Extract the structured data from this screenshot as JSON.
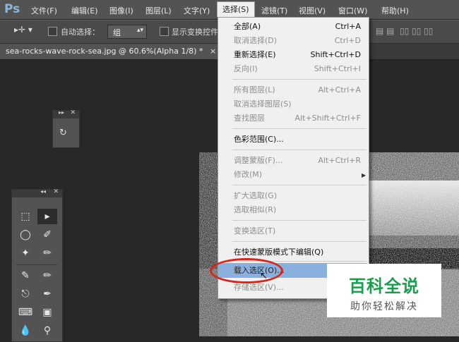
{
  "app": {
    "logo": "Ps"
  },
  "menubar": [
    {
      "label": "文件(F)"
    },
    {
      "label": "编辑(E)"
    },
    {
      "label": "图像(I)"
    },
    {
      "label": "图层(L)"
    },
    {
      "label": "文字(Y)"
    },
    {
      "label": "选择(S)"
    },
    {
      "label": "滤镜(T)"
    },
    {
      "label": "视图(V)"
    },
    {
      "label": "窗口(W)"
    },
    {
      "label": "帮助(H)"
    }
  ],
  "options": {
    "auto_select_label": "自动选择：",
    "auto_select_value": "组",
    "show_transform_label": "显示变换控件"
  },
  "document_tab": {
    "title": "sea-rocks-wave-rock-sea.jpg @ 60.6%(Alpha 1/8) *",
    "close": "×"
  },
  "select_menu": {
    "items": [
      {
        "label": "全部(A)",
        "shortcut": "Ctrl+A",
        "enabled": true
      },
      {
        "label": "取消选择(D)",
        "shortcut": "Ctrl+D",
        "enabled": false
      },
      {
        "label": "重新选择(E)",
        "shortcut": "Shift+Ctrl+D",
        "enabled": true
      },
      {
        "label": "反向(I)",
        "shortcut": "Shift+Ctrl+I",
        "enabled": false
      },
      {
        "label": "所有图层(L)",
        "shortcut": "Alt+Ctrl+A",
        "enabled": false
      },
      {
        "label": "取消选择图层(S)",
        "shortcut": "",
        "enabled": false
      },
      {
        "label": "查找图层",
        "shortcut": "Alt+Shift+Ctrl+F",
        "enabled": false
      },
      {
        "label": "色彩范围(C)...",
        "shortcut": "",
        "enabled": true
      },
      {
        "label": "调整蒙版(F)...",
        "shortcut": "Alt+Ctrl+R",
        "enabled": false
      },
      {
        "label": "修改(M)",
        "shortcut": "",
        "enabled": false,
        "submenu": true
      },
      {
        "label": "扩大选取(G)",
        "shortcut": "",
        "enabled": false
      },
      {
        "label": "选取相似(R)",
        "shortcut": "",
        "enabled": false
      },
      {
        "label": "变换选区(T)",
        "shortcut": "",
        "enabled": false
      },
      {
        "label": "在快速蒙版模式下编辑(Q)",
        "shortcut": "",
        "enabled": true
      },
      {
        "label": "载入选区(O)...",
        "shortcut": "",
        "enabled": true,
        "highlighted": true
      },
      {
        "label": "存储选区(V)...",
        "shortcut": "",
        "enabled": false
      }
    ]
  },
  "watermark": {
    "title": "百科全说",
    "subtitle": "助你轻松解决"
  },
  "colors": {
    "highlight": "#8ab0dd",
    "annotation": "#d8261d",
    "watermark_green": "#1a9e4b"
  }
}
